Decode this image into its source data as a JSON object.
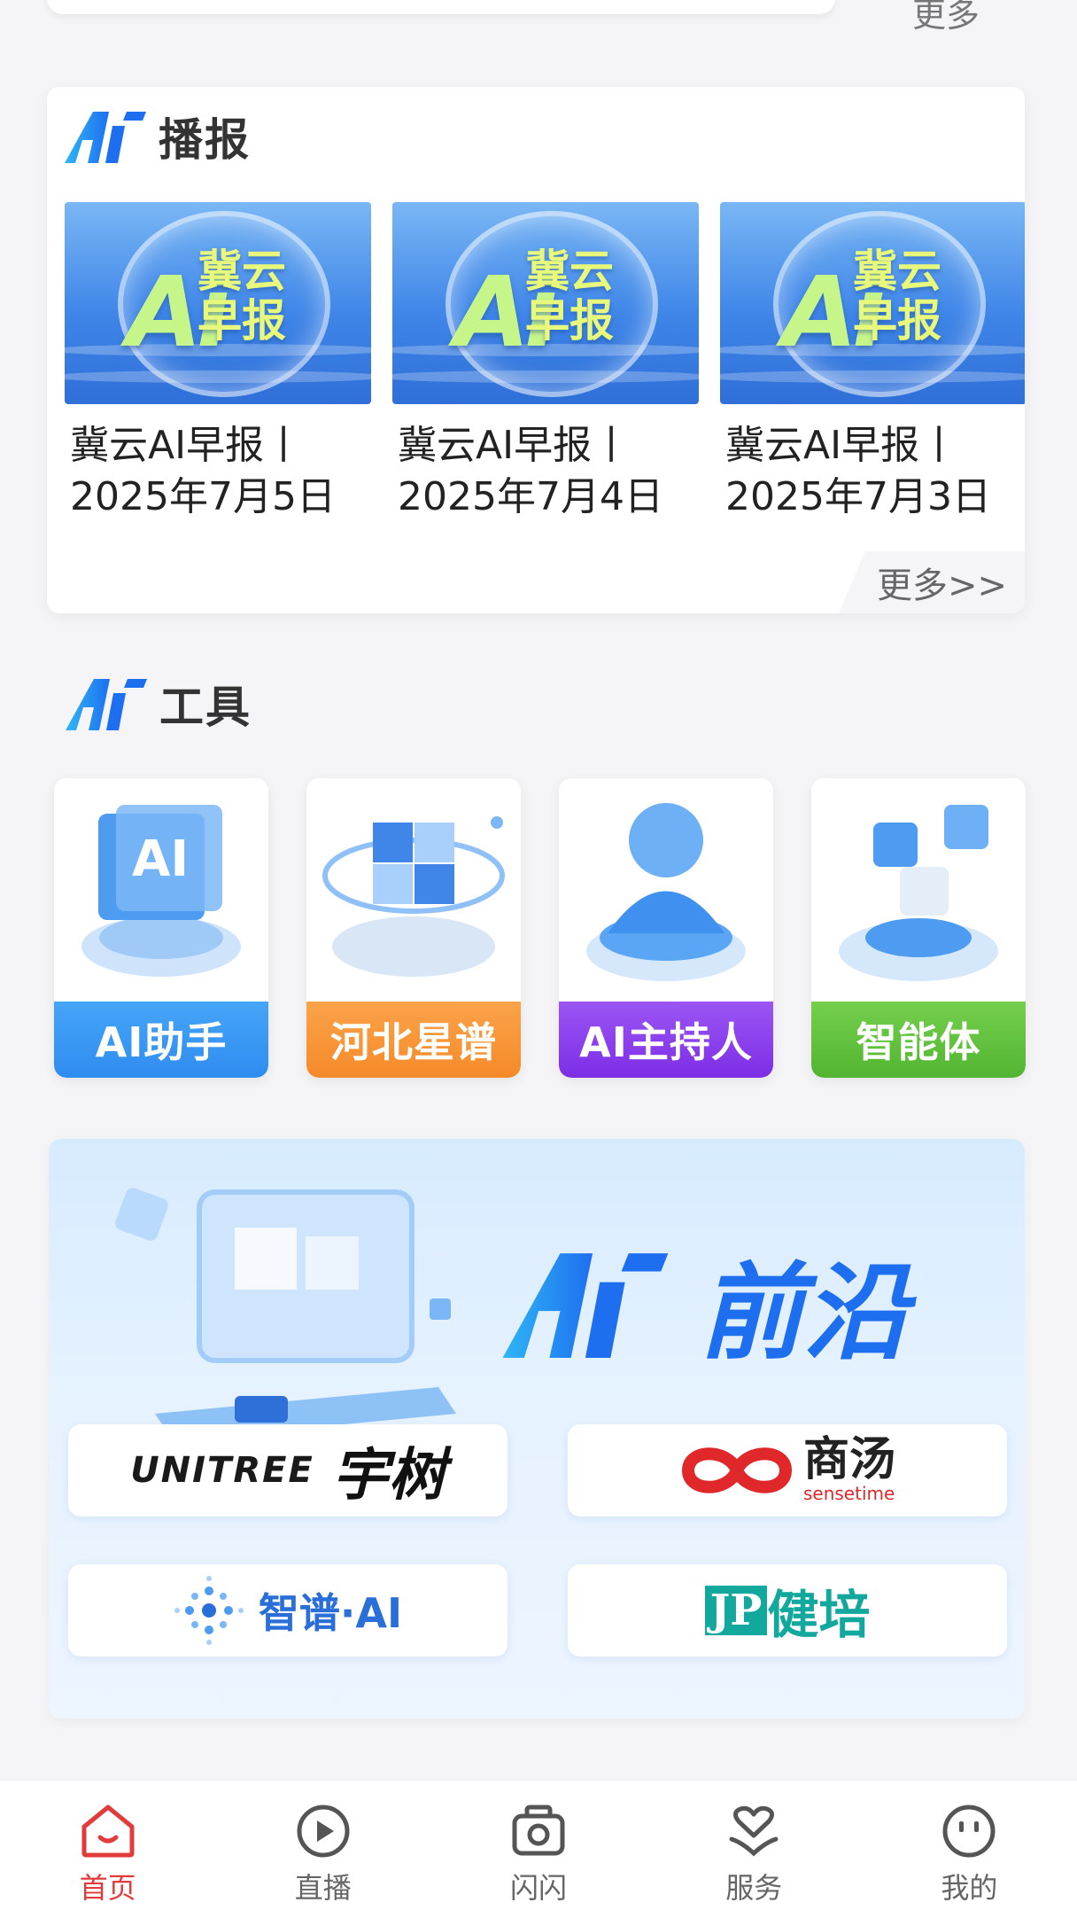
{
  "top": {
    "more_label": "更多"
  },
  "broadcast": {
    "title": "播报",
    "videos": [
      {
        "title": "冀云AI早报丨\n2025年7月5日",
        "thumb_ai": "Ai",
        "thumb_cn": "冀云\n早报"
      },
      {
        "title": "冀云AI早报丨\n2025年7月4日",
        "thumb_ai": "Ai",
        "thumb_cn": "冀云\n早报"
      },
      {
        "title": "冀云AI早报丨\n2025年7月3日",
        "thumb_ai": "Ai",
        "thumb_cn": "冀云\n早报"
      }
    ],
    "more_label": "更多>>"
  },
  "tools": {
    "title": "工具",
    "items": [
      {
        "label": "AI助手",
        "icon": "ai-assistant-icon",
        "color": "#2f8cf0"
      },
      {
        "label": "河北星谱",
        "icon": "hebei-star-icon",
        "color": "#f58a2a"
      },
      {
        "label": "AI主持人",
        "icon": "ai-host-icon",
        "color": "#8a3cf0"
      },
      {
        "label": "智能体",
        "icon": "agent-icon",
        "color": "#5fbe3a"
      }
    ]
  },
  "frontier": {
    "title": "前沿",
    "partners": {
      "unitree_en": "UNITREE",
      "unitree_cn": "宇树",
      "sense_cn": "商汤",
      "sense_en": "sensetime",
      "zhipu": "智谱·AI",
      "jp_mark": "JP",
      "jp_cn": "健培"
    }
  },
  "nav": {
    "items": [
      {
        "label": "首页",
        "icon": "home-icon",
        "active": true
      },
      {
        "label": "直播",
        "icon": "play-icon",
        "active": false
      },
      {
        "label": "闪闪",
        "icon": "camera-icon",
        "active": false
      },
      {
        "label": "服务",
        "icon": "heart-hand-icon",
        "active": false
      },
      {
        "label": "我的",
        "icon": "profile-face-icon",
        "active": false
      }
    ]
  },
  "colors": {
    "accent": "#e23b3b",
    "brand_blue": "#1e6ff0"
  }
}
